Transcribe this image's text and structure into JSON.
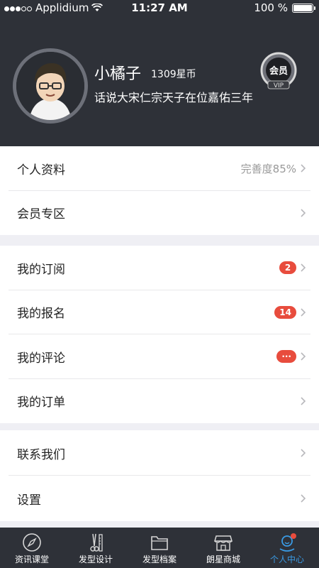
{
  "status_bar": {
    "carrier": "Applidium",
    "time": "11:27 AM",
    "battery": "100 %"
  },
  "profile": {
    "name": "小橘子",
    "coins": "1309星币",
    "motto": "话说大宋仁宗天子在位嘉佑三年",
    "vip_badge_text": "会员",
    "vip_badge_sub": "VIP"
  },
  "group1": [
    {
      "label": "个人资料",
      "value": "完善度85%"
    },
    {
      "label": "会员专区"
    }
  ],
  "group2": [
    {
      "label": "我的订阅",
      "badge": "2"
    },
    {
      "label": "我的报名",
      "badge": "14"
    },
    {
      "label": "我的评论",
      "badge": "···"
    },
    {
      "label": "我的订单"
    }
  ],
  "group3": [
    {
      "label": "联系我们"
    },
    {
      "label": "设置"
    }
  ],
  "tabbar": [
    {
      "label": "资讯课堂",
      "icon": "compass-icon"
    },
    {
      "label": "发型设计",
      "icon": "scissors-comb-icon"
    },
    {
      "label": "发型档案",
      "icon": "folder-icon"
    },
    {
      "label": "朗星商城",
      "icon": "store-icon"
    },
    {
      "label": "个人中心",
      "icon": "user-icon",
      "active": true
    }
  ],
  "colors": {
    "header_bg": "#2e3138",
    "accent": "#3a9be5",
    "badge": "#e84c3d"
  }
}
